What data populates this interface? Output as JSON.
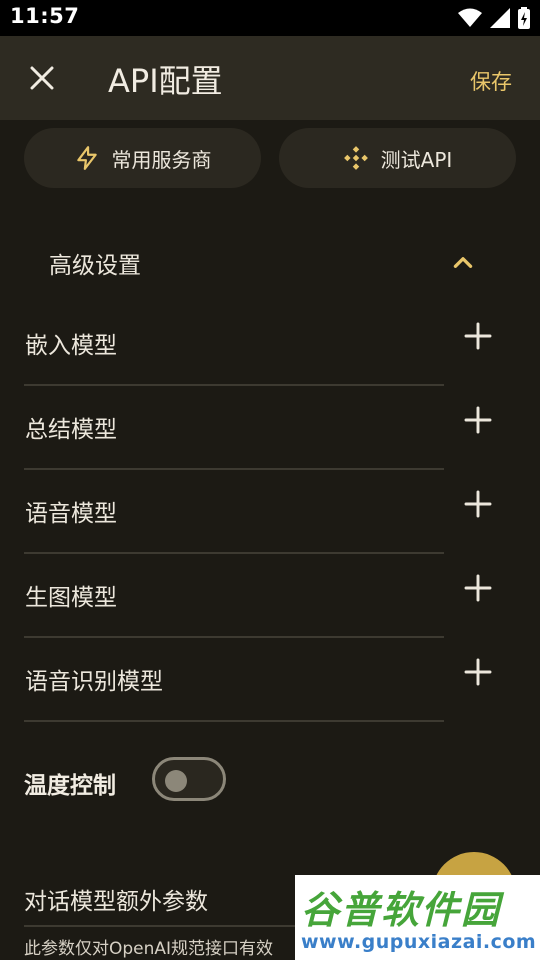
{
  "status_bar": {
    "time": "11:57"
  },
  "app_bar": {
    "title": "API配置",
    "save_label": "保存"
  },
  "chips": {
    "common_label": "常用服务商",
    "test_label": "测试API"
  },
  "advanced": {
    "title": "高级设置",
    "models": [
      {
        "label": "嵌入模型"
      },
      {
        "label": "总结模型"
      },
      {
        "label": "语音模型"
      },
      {
        "label": "生图模型"
      },
      {
        "label": "语音识别模型"
      }
    ]
  },
  "temperature": {
    "label": "温度控制",
    "enabled": false
  },
  "extra_params": {
    "label": "对话模型额外参数",
    "hint": "此参数仅对OpenAI规范接口有效"
  },
  "watermark": {
    "logo_text": "谷普软件园",
    "url": "www.gupuxiazai.com"
  },
  "colors": {
    "accent": "#e9c66a",
    "background": "#1c1a14",
    "appbar": "#2e2b22",
    "fab": "#c7a342"
  }
}
